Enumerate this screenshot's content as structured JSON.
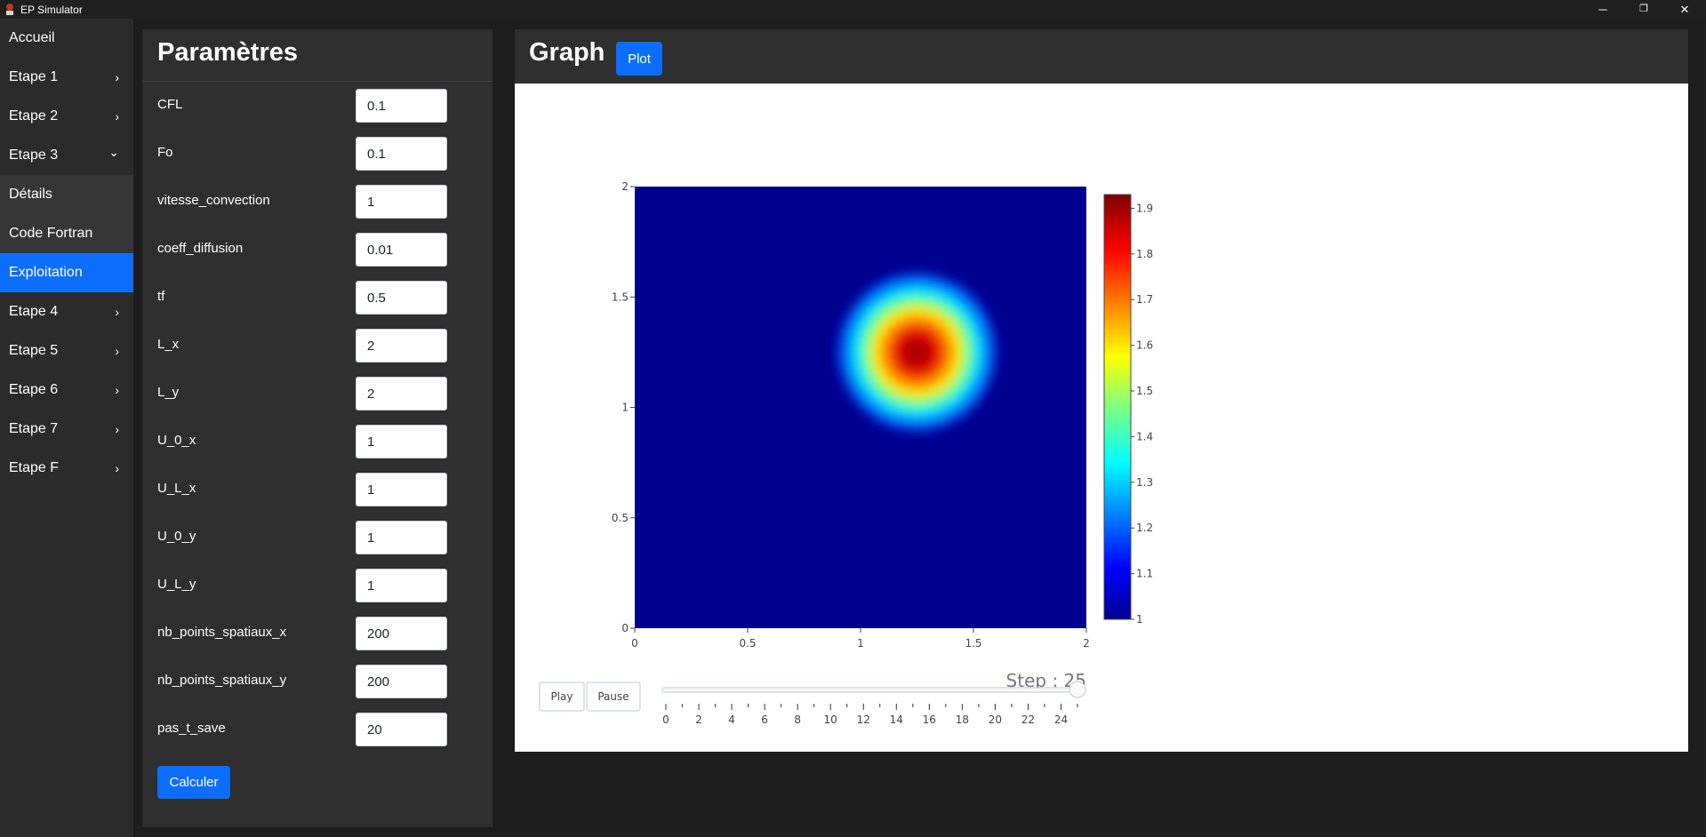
{
  "window": {
    "title": "EP Simulator",
    "controls": [
      "─",
      "❐",
      "✕"
    ]
  },
  "sidebar": {
    "items": [
      {
        "label": "Accueil",
        "arrow": ""
      },
      {
        "label": "Etape 1",
        "arrow": "›"
      },
      {
        "label": "Etape 2",
        "arrow": "›"
      },
      {
        "label": "Etape 3",
        "arrow": "⌄"
      },
      {
        "label": "Détails",
        "arrow": ""
      },
      {
        "label": "Code Fortran",
        "arrow": ""
      },
      {
        "label": "Exploitation",
        "arrow": ""
      },
      {
        "label": "Etape 4",
        "arrow": "›"
      },
      {
        "label": "Etape 5",
        "arrow": "›"
      },
      {
        "label": "Etape 6",
        "arrow": "›"
      },
      {
        "label": "Etape 7",
        "arrow": "›"
      },
      {
        "label": "Etape F",
        "arrow": "›"
      }
    ],
    "active_item": "Exploitation",
    "accent_color": "#0d6efd"
  },
  "params": {
    "title": "Paramètres",
    "fields": [
      {
        "label": "CFL",
        "value": "0.1"
      },
      {
        "label": "Fo",
        "value": "0.1"
      },
      {
        "label": "vitesse_convection",
        "value": "1"
      },
      {
        "label": "coeff_diffusion",
        "value": "0.01"
      },
      {
        "label": "tf",
        "value": "0.5"
      },
      {
        "label": "L_x",
        "value": "2"
      },
      {
        "label": "L_y",
        "value": "2"
      },
      {
        "label": "U_0_x",
        "value": "1"
      },
      {
        "label": "U_L_x",
        "value": "1"
      },
      {
        "label": "U_0_y",
        "value": "1"
      },
      {
        "label": "U_L_y",
        "value": "1"
      },
      {
        "label": "nb_points_spatiaux_x",
        "value": "200"
      },
      {
        "label": "nb_points_spatiaux_y",
        "value": "200"
      },
      {
        "label": "pas_t_save",
        "value": "20"
      }
    ],
    "submit_label": "Calculer"
  },
  "graph": {
    "title": "Graph",
    "plot_label": "Plot",
    "play_label": "Play",
    "pause_label": "Pause",
    "step_text": "Step : 25",
    "slider_value": 25,
    "slider_ticks": [
      "0",
      "2",
      "4",
      "6",
      "8",
      "10",
      "12",
      "14",
      "16",
      "18",
      "20",
      "22",
      "24"
    ]
  },
  "chart_data": {
    "type": "heatmap",
    "colorscale": "jet",
    "x_ticks": [
      "0",
      "0.5",
      "1",
      "1.5",
      "2"
    ],
    "y_ticks": [
      "0",
      "0.5",
      "1",
      "1.5",
      "2"
    ],
    "xlim": [
      0,
      2
    ],
    "ylim": [
      0,
      2
    ],
    "colorbar_ticks": [
      "1",
      "1.1",
      "1.2",
      "1.3",
      "1.4",
      "1.5",
      "1.6",
      "1.7",
      "1.8",
      "1.9"
    ],
    "zlim": [
      1,
      1.93
    ],
    "peak": {
      "x": 1.25,
      "y": 1.25,
      "value": 1.93
    }
  }
}
